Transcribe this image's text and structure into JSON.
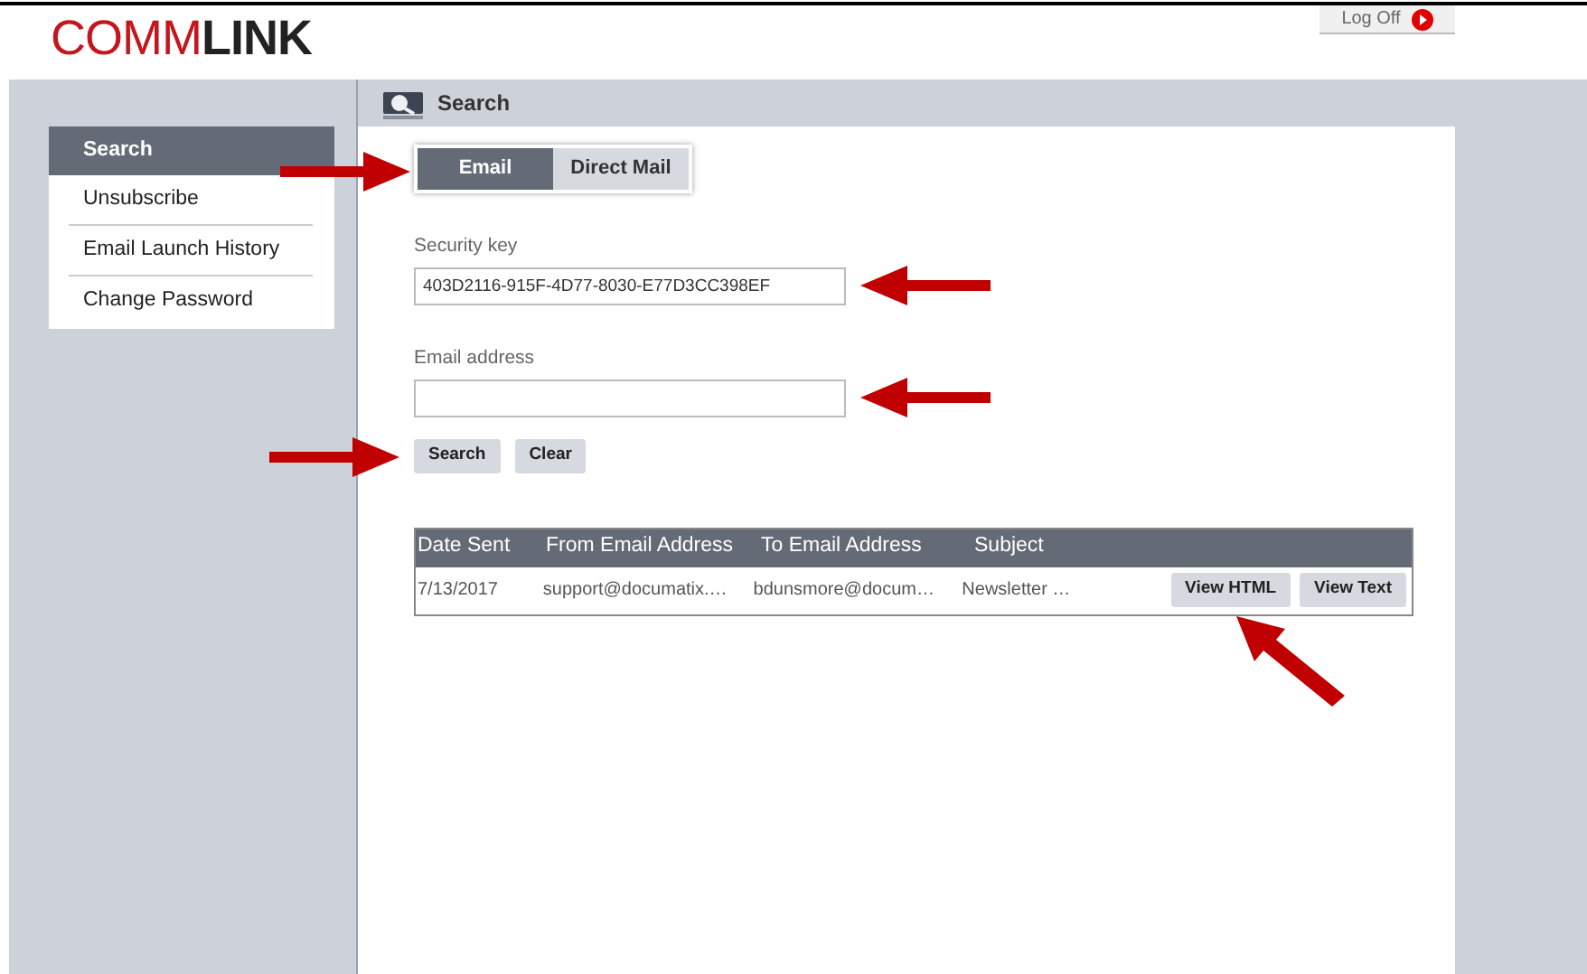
{
  "logo": {
    "light": "COMM",
    "bold": "LINK"
  },
  "logoff": {
    "label": "Log Off"
  },
  "sidebar": {
    "items": [
      {
        "label": "Search",
        "selected": true
      },
      {
        "label": "Unsubscribe",
        "selected": false
      },
      {
        "label": "Email Launch History",
        "selected": false
      },
      {
        "label": "Change Password",
        "selected": false
      }
    ]
  },
  "page_title": "Search",
  "tabs": {
    "pointer": {
      "kind": "right"
    },
    "items": [
      {
        "label": "Email",
        "selected": true
      },
      {
        "label": "Direct Mail",
        "selected": false
      }
    ]
  },
  "fields": [
    {
      "label": "Security key",
      "value": "403D2116-915F-4D77-8030-E77D3CC398EF",
      "pointer": {
        "kind": "left"
      }
    },
    {
      "label": "Email address",
      "pointer": {
        "kind": "left"
      }
    }
  ],
  "buttons": {
    "pointer": {
      "kind": "right"
    },
    "items": [
      "Search",
      "Clear"
    ]
  },
  "table": {
    "columns": [
      "Date Sent",
      "From Email Address",
      "To Email Address",
      "Subject"
    ],
    "rows": [
      {
        "cells": [
          "7/13/2017",
          "support@documatix.…",
          "bdunsmore@docum…",
          "Newsletter …"
        ],
        "actions": [
          {
            "label": "View HTML",
            "pointer": {
              "kind": "diagonal"
            }
          },
          {
            "label": "View Text"
          }
        ]
      }
    ]
  }
}
